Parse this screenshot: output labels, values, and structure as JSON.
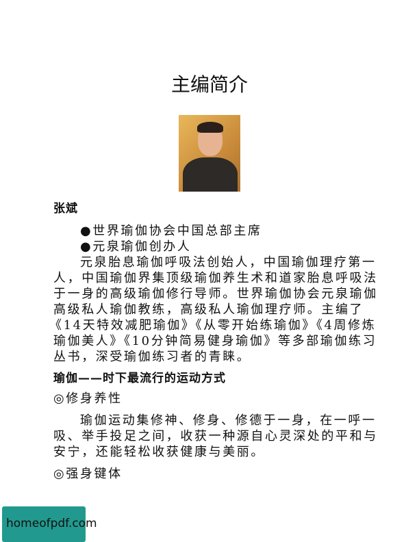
{
  "title": "主编简介",
  "author": {
    "name": "张斌",
    "bullets": [
      "●世界瑜伽协会中国总部主席",
      "●元泉瑜伽创办人"
    ],
    "bio_lines": [
      "元泉胎息瑜伽呼吸法创始人，中国瑜伽理疗第一",
      "人，中国瑜伽界集顶级瑜伽养生术和道家胎息呼吸法",
      "于一身的高级瑜伽修行导师。世界瑜伽协会元泉瑜伽",
      "高级私人瑜伽教练，高级私人瑜伽理疗师。主编了",
      "《14天特效减肥瑜伽》《从零开始练瑜伽》《4周修炼",
      "瑜伽美人》《10分钟简易健身瑜伽》等多部瑜伽练习",
      "丛书，深受瑜伽练习者的青睐。"
    ]
  },
  "section": {
    "heading": "瑜伽——时下最流行的运动方式",
    "sub1": "◎修身养性",
    "para_lines": [
      "瑜伽运动集修神、修身、修德于一身，在一呼一",
      "吸、举手投足之间，收获一种源自心灵深处的平和与",
      "安宁，还能轻松收获健康与美丽。"
    ],
    "sub2": "◎强身键体"
  },
  "watermark": "homeofpdf.com",
  "colors": {
    "watermark_bg": "#22998f"
  }
}
